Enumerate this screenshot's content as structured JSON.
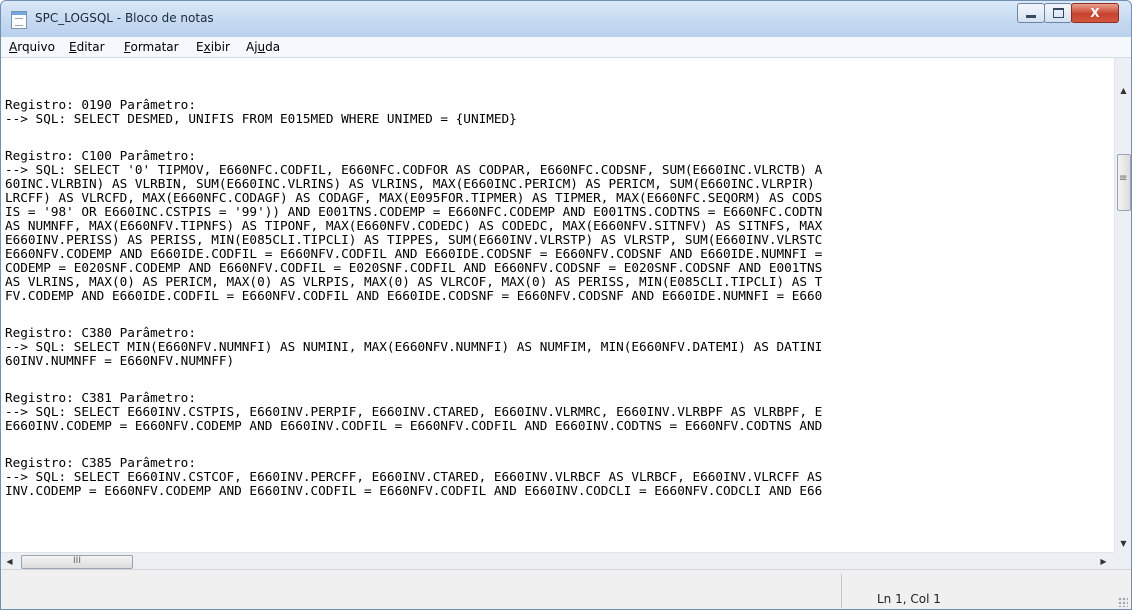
{
  "window": {
    "title": "SPC_LOGSQL - Bloco de notas",
    "close_glyph": "X"
  },
  "menu": [
    {
      "accel": "A",
      "rest": "rquivo"
    },
    {
      "accel": "E",
      "rest": "ditar"
    },
    {
      "accel": "F",
      "rest": "ormatar"
    },
    {
      "pre": "E",
      "accel": "x",
      "rest": "ibir"
    },
    {
      "pre": "Aj",
      "accel": "u",
      "rest": "da"
    }
  ],
  "editor": {
    "lines": [
      "Registro: 0190 Parâmetro:",
      "--> SQL: SELECT DESMED, UNIFIS FROM E015MED WHERE UNIMED = {UNIMED}",
      "Registro: C100 Parâmetro:",
      "--> SQL: SELECT '0' TIPMOV, E660NFC.CODFIL, E660NFC.CODFOR AS CODPAR, E660NFC.CODSNF, SUM(E660INC.VLRCTB) A",
      "60INC.VLRBIN) AS VLRBIN, SUM(E660INC.VLRINS) AS VLRINS, MAX(E660INC.PERICM) AS PERICM, SUM(E660INC.VLRPIR)",
      "LRCFF) AS VLRCFD, MAX(E660NFC.CODAGF) AS CODAGF, MAX(E095FOR.TIPMER) AS TIPMER, MAX(E660NFC.SEQORM) AS CODS",
      "IS = '98' OR E660INC.CSTPIS = '99')) AND E001TNS.CODEMP = E660NFC.CODEMP AND E001TNS.CODTNS = E660NFC.CODTN",
      "AS NUMNFF, MAX(E660NFV.TIPNFS) AS TIPONF, MAX(E660NFV.CODEDC) AS CODEDC, MAX(E660NFV.SITNFV) AS SITNFS, MAX",
      "E660INV.PERISS) AS PERISS, MIN(E085CLI.TIPCLI) AS TIPPES, SUM(E660INV.VLRSTP) AS VLRSTP, SUM(E660INV.VLRSTC",
      "E660NFV.CODEMP AND E660IDE.CODFIL = E660NFV.CODFIL AND E660IDE.CODSNF = E660NFV.CODSNF AND E660IDE.NUMNFI =",
      "CODEMP = E020SNF.CODEMP AND E660NFV.CODFIL = E020SNF.CODFIL AND E660NFV.CODSNF = E020SNF.CODSNF AND E001TNS",
      "AS VLRINS, MAX(0) AS PERICM, MAX(0) AS VLRPIS, MAX(0) AS VLRCOF, MAX(0) AS PERISS, MIN(E085CLI.TIPCLI) AS T",
      "FV.CODEMP AND E660IDE.CODFIL = E660NFV.CODFIL AND E660IDE.CODSNF = E660NFV.CODSNF AND E660IDE.NUMNFI = E660",
      "Registro: C380 Parâmetro:",
      "--> SQL: SELECT MIN(E660NFV.NUMNFI) AS NUMINI, MAX(E660NFV.NUMNFI) AS NUMFIM, MIN(E660NFV.DATEMI) AS DATINI",
      "60INV.NUMNFF = E660NFV.NUMNFF)",
      "Registro: C381 Parâmetro:",
      "--> SQL: SELECT E660INV.CSTPIS, E660INV.PERPIF, E660INV.CTARED, E660INV.VLRMRC, E660INV.VLRBPF AS VLRBPF, E",
      "E660INV.CODEMP = E660NFV.CODEMP AND E660INV.CODFIL = E660NFV.CODFIL AND E660INV.CODTNS = E660NFV.CODTNS AND",
      "Registro: C385 Parâmetro:",
      "--> SQL: SELECT E660INV.CSTCOF, E660INV.PERCFF, E660INV.CTARED, E660INV.VLRBCF AS VLRBCF, E660INV.VLRCFF AS",
      "INV.CODEMP = E660NFV.CODEMP AND E660INV.CODFIL = E660NFV.CODFIL AND E660INV.CODCLI = E660NFV.CODCLI AND E66"
    ]
  },
  "scrollbars": {
    "up": "▲",
    "down": "▼",
    "left": "◀",
    "right": "▶",
    "h_thumb_grip": "III"
  },
  "status": {
    "position": "Ln 1, Col 1"
  }
}
